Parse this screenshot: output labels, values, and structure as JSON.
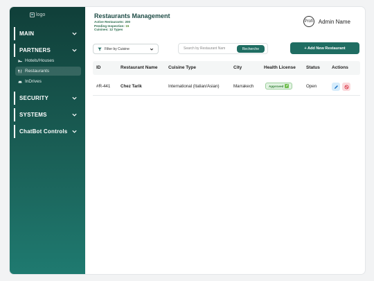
{
  "sidebar": {
    "logo_alt": "logo",
    "sections": {
      "main": "MAIN",
      "partners": "PARTNERS",
      "security": "SECURITY",
      "systems": "SYSTEMS",
      "chatbot": "ChatBot Controls"
    },
    "partner_items": {
      "hotels": "Hotels/Houses",
      "restaurants": "Restaurants",
      "indrives": "InDrives"
    }
  },
  "header": {
    "title": "Restaurants Management",
    "stats": {
      "active_label": "Active Restaurants:",
      "active_value": "200",
      "pending_label": "Pending Inspection:",
      "pending_value": "15",
      "cuisines_label": "Cuisines:",
      "cuisines_value": "12 Types"
    },
    "avatar_text": "Profi",
    "admin_name": "Admin Name"
  },
  "toolbar": {
    "filter_label": "Filter by Cuisine",
    "search_placeholder": "Search by Restaurant Nam",
    "search_button": "Recherche",
    "add_button": "+ Add New Restaurant"
  },
  "table": {
    "columns": {
      "id": "ID",
      "name": "Restaurant Name",
      "cuisine": "Cuisine Type",
      "city": "City",
      "license": "Health License",
      "status": "Status",
      "actions": "Actions"
    },
    "rows": [
      {
        "id": "#R-441",
        "name": "Chez Tarik",
        "cuisine": "International (Italian/Asian)",
        "city": "Marrakech",
        "license": "Approved",
        "status": "Open"
      }
    ]
  },
  "colors": {
    "accent": "#1f6d62",
    "sidebar_top": "#103f39",
    "sidebar_bottom": "#1f7a70",
    "approved": "#2e7d32",
    "edit": "#1a73c8",
    "delete": "#d93645"
  }
}
